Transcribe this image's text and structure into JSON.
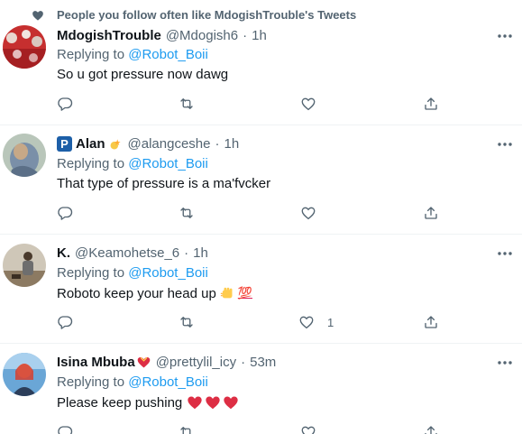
{
  "context": {
    "label": "People you follow often like MdogishTrouble's Tweets",
    "icon": "heart-icon"
  },
  "colors": {
    "link": "#1d9bf0",
    "secondary_text": "#536471",
    "primary_text": "#0f1419",
    "divider": "#eff3f4",
    "heart_red": "#e0245e"
  },
  "tweets": [
    {
      "name": "MdogishTrouble",
      "handle": "@Mdogish6",
      "sep": "·",
      "time": "1h",
      "replying_prefix": "Replying to",
      "replying_to": "@Robot_Boii",
      "text": "So u got pressure now  dawg",
      "likes": ""
    },
    {
      "name": "Alan",
      "handle": "@alangceshe",
      "sep": "·",
      "time": "1h",
      "badge": "P",
      "replying_prefix": "Replying to",
      "replying_to": "@Robot_Boii",
      "text": "That type of pressure is a ma'fvcker",
      "likes": ""
    },
    {
      "name": "K.",
      "handle": "@Keamohetse_6",
      "sep": "·",
      "time": "1h",
      "replying_prefix": "Replying to",
      "replying_to": "@Robot_Boii",
      "text": "Roboto keep your head up",
      "emoji_text": "💯",
      "likes": "1"
    },
    {
      "name": "Isina Mbuba",
      "handle": "@prettylil_icy",
      "sep": "·",
      "time": "53m",
      "replying_prefix": "Replying to",
      "replying_to": "@Robot_Boii",
      "text": "Please keep pushing",
      "likes": ""
    }
  ]
}
